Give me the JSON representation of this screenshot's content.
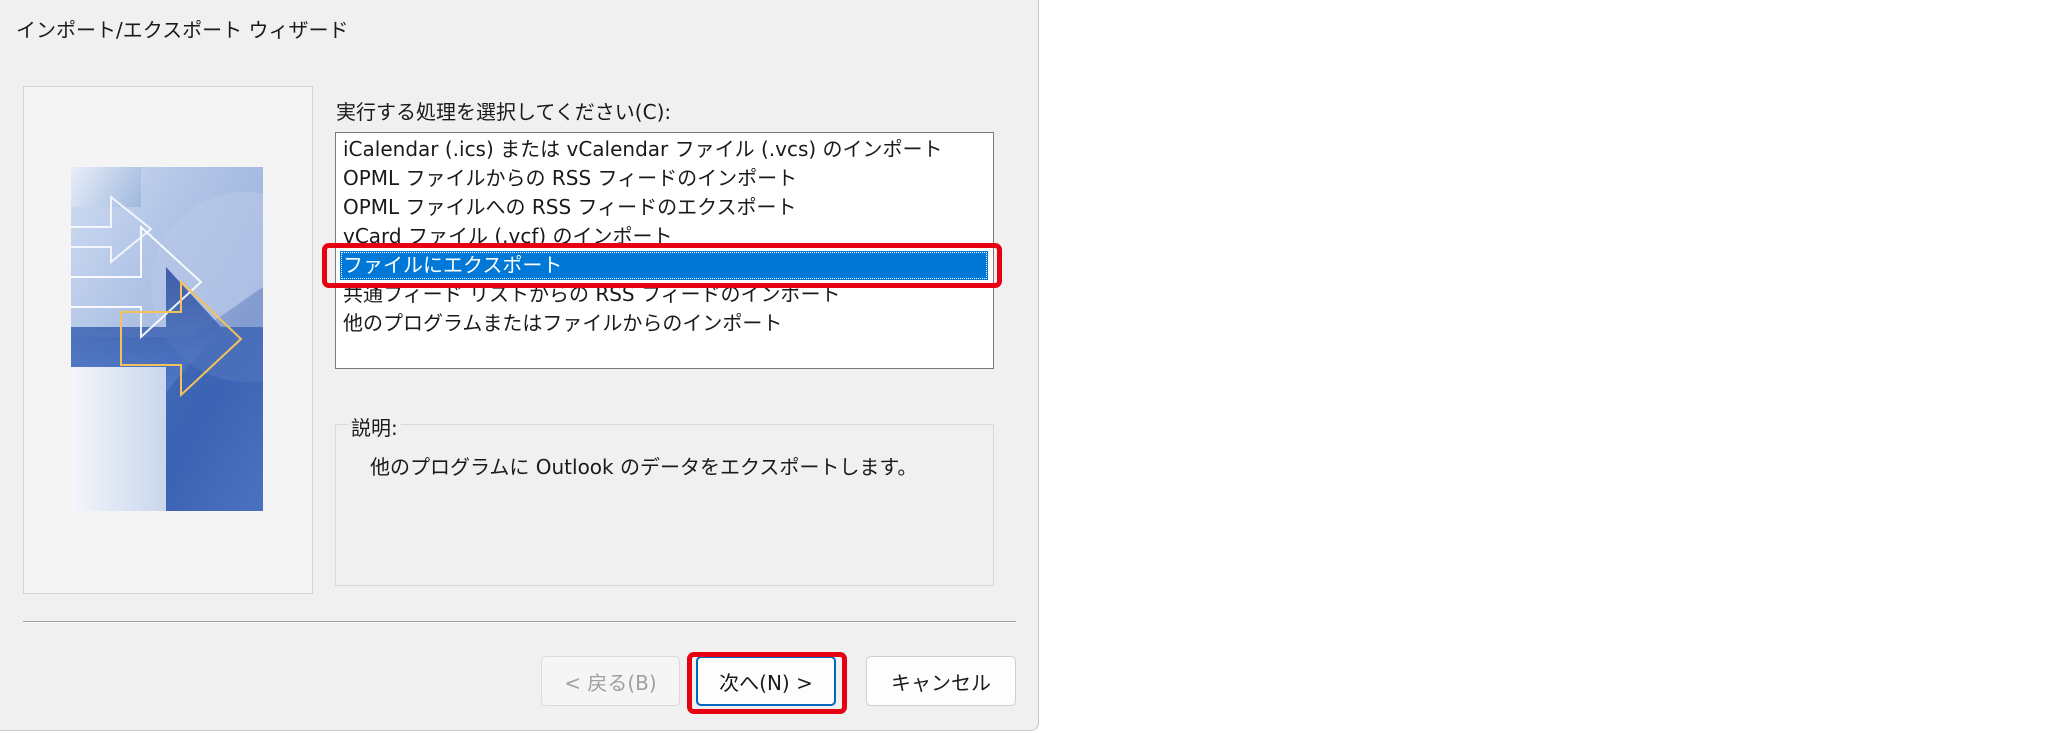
{
  "window": {
    "title": "インポート/エクスポート ウィザード"
  },
  "main": {
    "prompt": "実行する処理を選択してください(C):",
    "options": [
      "iCalendar (.ics) または vCalendar ファイル (.vcs) のインポート",
      "OPML ファイルからの RSS フィードのインポート",
      "OPML ファイルへの RSS フィードのエクスポート",
      "vCard ファイル (.vcf) のインポート",
      "ファイルにエクスポート",
      "共通フィード リストからの RSS フィードのインポート",
      "他のプログラムまたはファイルからのインポート"
    ],
    "selected_option": "ファイルにエクスポート",
    "description_caption": "説明:",
    "description_text": "他のプログラムに Outlook のデータをエクスポートします。"
  },
  "buttons": {
    "back": "< 戻る(B)",
    "next": "次へ(N) >",
    "cancel": "キャンセル"
  },
  "colors": {
    "selection": "#0078d7",
    "highlight_annotation": "#e60012",
    "dialog_background": "#f0f0f0"
  }
}
